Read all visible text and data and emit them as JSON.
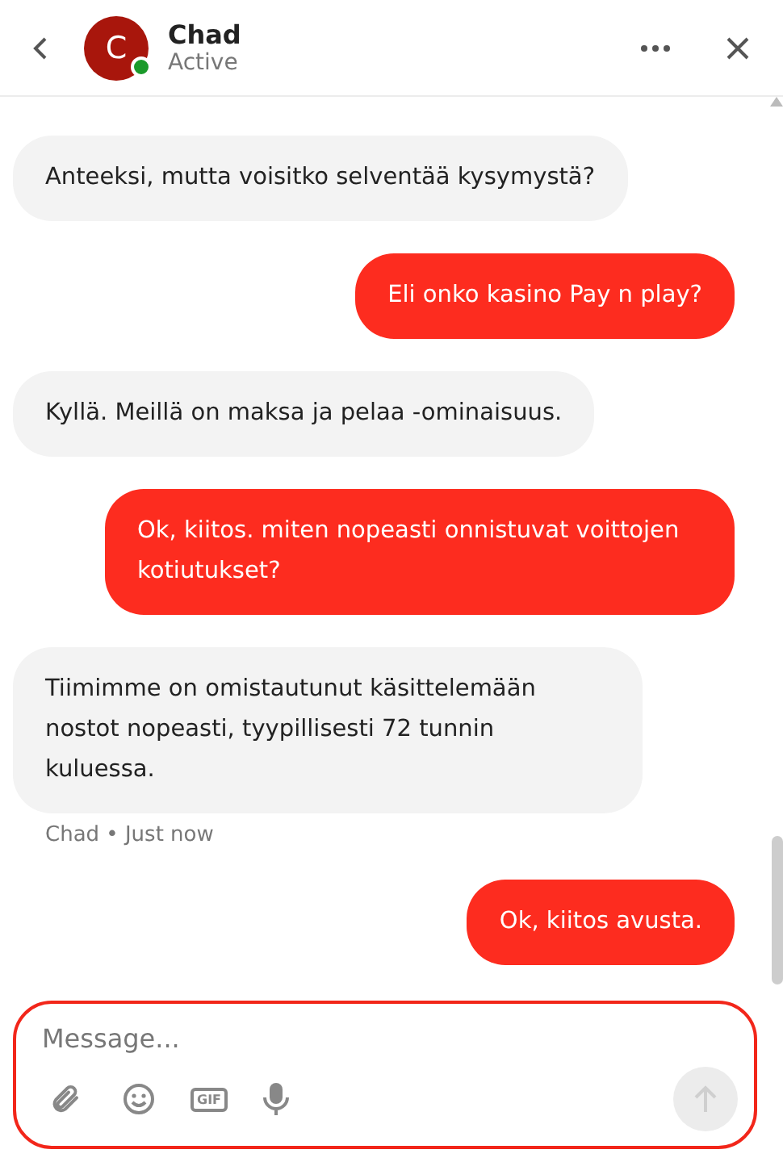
{
  "header": {
    "name": "Chad",
    "status": "Active",
    "avatar_letter": "C",
    "online": true
  },
  "messages": [
    {
      "kind": "received",
      "text": "Anteeksi, mutta voisitko selventää kysymystä?"
    },
    {
      "kind": "sent",
      "text": "Eli onko kasino Pay n play?"
    },
    {
      "kind": "received",
      "text": "Kyllä. Meillä on maksa ja pelaa -ominaisuus."
    },
    {
      "kind": "sent",
      "text": "Ok, kiitos. miten nopeasti onnistuvat voittojen kotiutukset?"
    },
    {
      "kind": "received",
      "text": "Tiimimme on omistautunut käsittelemään nostot nopeasti, tyypillisesti 72 tunnin kuluessa.",
      "meta": "Chad • Just now"
    },
    {
      "kind": "sent",
      "text": "Ok, kiitos avusta."
    }
  ],
  "composer": {
    "placeholder": "Message...",
    "gif_label": "GIF",
    "send_disabled": true
  }
}
